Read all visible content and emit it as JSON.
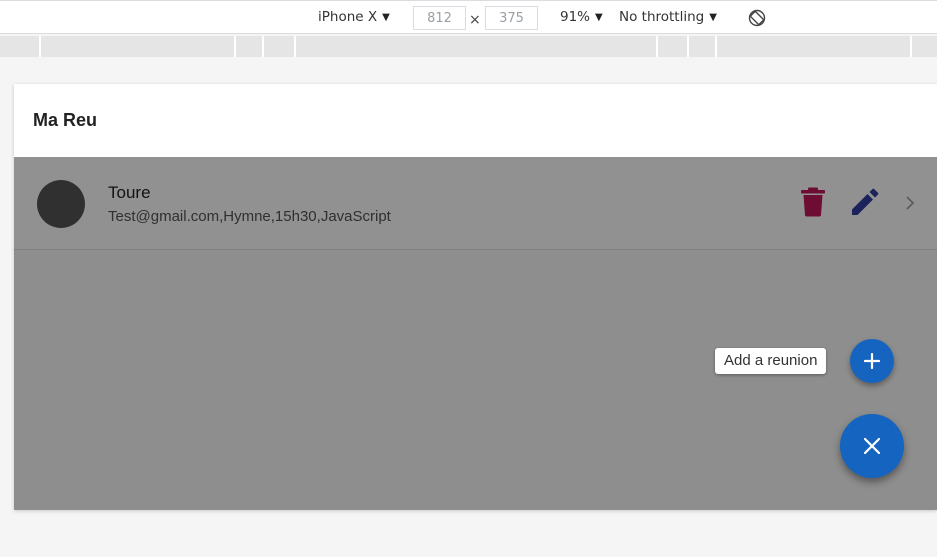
{
  "devtools": {
    "device": "iPhone X",
    "width": "812",
    "height": "375",
    "times_symbol": "×",
    "zoom": "91%",
    "throttling": "No throttling",
    "rotate_icon": "rotate-icon"
  },
  "app": {
    "title": "Ma Reu",
    "list": [
      {
        "name": "Toure",
        "details": "Test@gmail.com,Hymne,15h30,JavaScript"
      }
    ],
    "fab": {
      "tooltip": "Add a reunion",
      "mini_icon": "plus-icon",
      "main_icon": "close-icon"
    },
    "colors": {
      "accent": "#1565c0",
      "delete": "#c2185b",
      "edit": "#303f9f",
      "avatar": "#555555"
    }
  }
}
